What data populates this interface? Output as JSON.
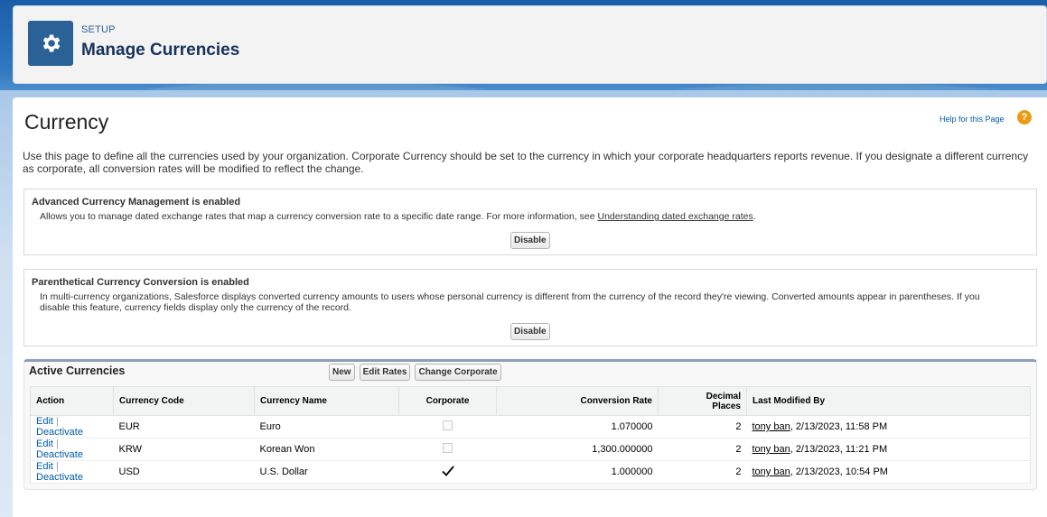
{
  "header": {
    "label": "SETUP",
    "title": "Manage Currencies"
  },
  "page": {
    "title": "Currency",
    "help_link": "Help for this Page",
    "help_icon": "?",
    "intro": "Use this page to define all the currencies used by your organization. Corporate Currency should be set to the currency in which your corporate headquarters reports revenue. If you designate a different currency as corporate, all conversion rates will be modified to reflect the change."
  },
  "advanced": {
    "title": "Advanced Currency Management is enabled",
    "desc_prefix": "Allows you to manage dated exchange rates that map a currency conversion rate to a specific date range. For more information, see ",
    "desc_link": "Understanding dated exchange rates",
    "desc_suffix": ".",
    "button": "Disable"
  },
  "parenthetical": {
    "title": "Parenthetical Currency Conversion is enabled",
    "desc": "In multi-currency organizations, Salesforce displays converted currency amounts to users whose personal currency is different from the currency of the record they're viewing. Converted amounts appear in parentheses. If you disable this feature, currency fields display only the currency of the record.",
    "button": "Disable"
  },
  "active_currencies": {
    "title": "Active Currencies",
    "buttons": {
      "new": "New",
      "edit_rates": "Edit Rates",
      "change_corporate": "Change Corporate"
    },
    "columns": {
      "action": "Action",
      "code": "Currency Code",
      "name": "Currency Name",
      "corporate": "Corporate",
      "rate": "Conversion Rate",
      "decimal_line1": "Decimal",
      "decimal_line2": "Places",
      "modified": "Last Modified By"
    },
    "rows": [
      {
        "edit": "Edit",
        "sep": "|",
        "deactivate": "Deactivate",
        "code": "EUR",
        "name": "Euro",
        "corporate": false,
        "rate": "1.070000",
        "decimals": "2",
        "user": "tony ban",
        "modified": ", 2/13/2023, 11:58 PM"
      },
      {
        "edit": "Edit",
        "sep": "|",
        "deactivate": "Deactivate",
        "code": "KRW",
        "name": "Korean Won",
        "corporate": false,
        "rate": "1,300.000000",
        "decimals": "2",
        "user": "tony ban",
        "modified": ", 2/13/2023, 11:21 PM"
      },
      {
        "edit": "Edit",
        "sep": "|",
        "deactivate": "Deactivate",
        "code": "USD",
        "name": "U.S. Dollar",
        "corporate": true,
        "rate": "1.000000",
        "decimals": "2",
        "user": "tony ban",
        "modified": ", 2/13/2023, 10:54 PM"
      }
    ]
  },
  "colors": {
    "accent": "#015ba7",
    "gear_bg": "#2a6196",
    "help_icon": "#e89b14"
  },
  "icons": {
    "gear": "gear-icon",
    "check": "checkmark-icon",
    "unchecked": "unchecked-box-icon"
  }
}
